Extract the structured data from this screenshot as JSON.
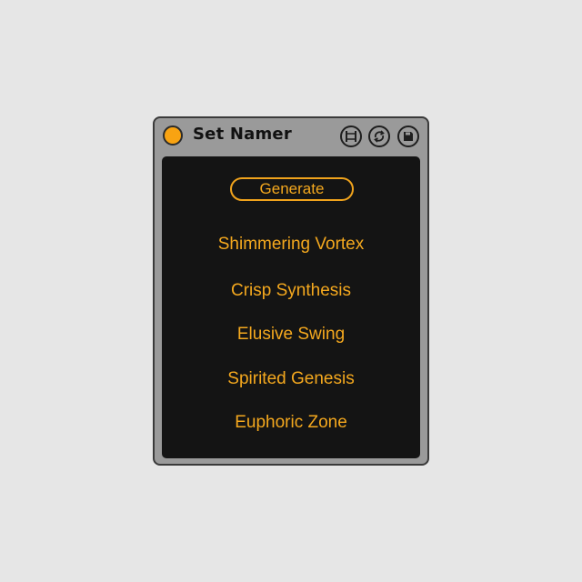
{
  "device": {
    "title": "Set Namer",
    "accent_color": "#f4a81e",
    "power_color": "#f8a312",
    "controls": [
      {
        "icon": "fold-icon"
      },
      {
        "icon": "hot-swap-icon"
      },
      {
        "icon": "save-icon"
      }
    ]
  },
  "main": {
    "generate_label": "Generate",
    "names": [
      "Shimmering Vortex",
      "Crisp Synthesis",
      "Elusive Swing",
      "Spirited Genesis",
      "Euphoric Zone"
    ]
  }
}
